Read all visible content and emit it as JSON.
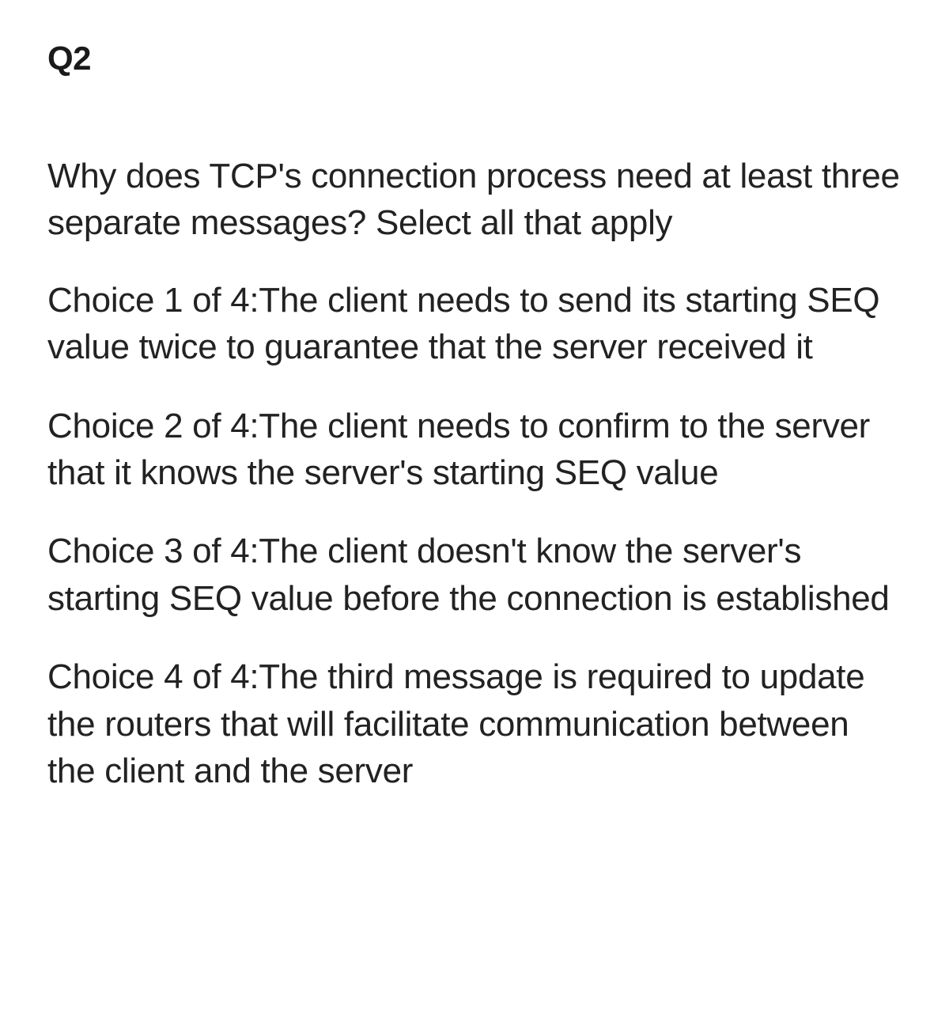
{
  "question": {
    "number": "Q2",
    "prompt": "Why does TCP's connection process need at least three separate messages? Select all that apply",
    "choices": [
      "Choice 1 of 4:The client needs to send its starting SEQ value twice to guarantee that the server received it",
      "Choice 2 of 4:The client needs to confirm to the server that it knows the server's starting SEQ value",
      "Choice 3 of 4:The client doesn't know the server's starting SEQ value before the connection is established",
      "Choice 4 of 4:The third message is required to update the routers that will facilitate communication between the client and the server"
    ]
  }
}
